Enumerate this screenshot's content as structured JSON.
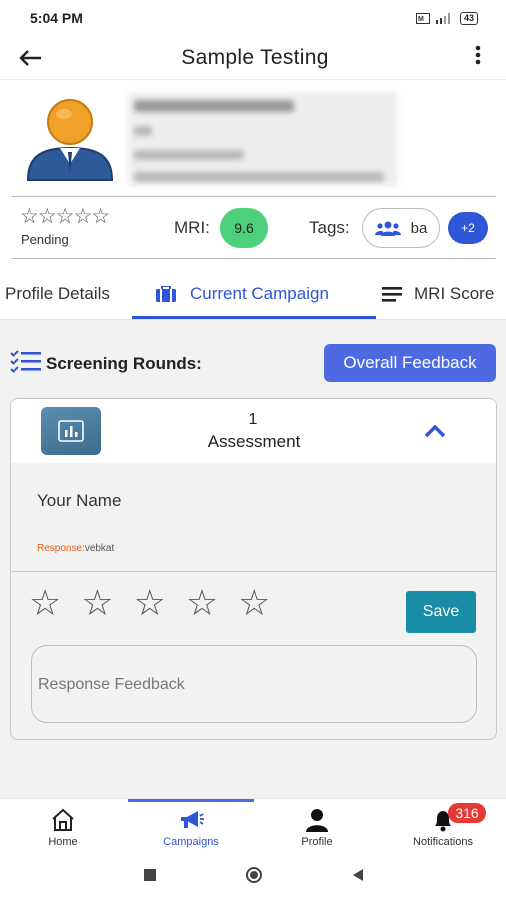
{
  "status_bar": {
    "time": "5:04 PM",
    "battery": "43"
  },
  "app_bar": {
    "back_icon": "arrow-left-icon",
    "title": "Sample Testing",
    "more_icon": "more-vertical-icon"
  },
  "profile": {
    "avatar_icon": "user-avatar-icon"
  },
  "meta": {
    "rating_stars": "☆☆☆☆☆",
    "status": "Pending",
    "mri_label": "MRI:",
    "mri_value": "9.6",
    "mri_color": "#4cd07a",
    "tags_label": "Tags:",
    "tag_icon": "group-icon",
    "tag_text": "ba",
    "tag_more": "+2"
  },
  "tabs": [
    {
      "label": "Profile Details"
    },
    {
      "label": "Current Campaign",
      "icon": "briefcase-icon",
      "active": true
    },
    {
      "label": "MRI Score",
      "icon": "menu-lines-icon"
    }
  ],
  "screening": {
    "icon": "checklist-icon",
    "label": "Screening Rounds:",
    "overall_feedback": "Overall Feedback"
  },
  "assessment": {
    "icon": "chart-icon",
    "number": "1",
    "title": "Assessment",
    "question": "Your Name",
    "response_key": "Response:",
    "response_value": "vebkat",
    "rating": "☆",
    "save_label": "Save",
    "feedback_placeholder": "Response Feedback"
  },
  "bottom_nav": [
    {
      "label": "Home",
      "icon": "home-icon"
    },
    {
      "label": "Campaigns",
      "icon": "megaphone-icon",
      "active": true
    },
    {
      "label": "Profile",
      "icon": "person-icon"
    },
    {
      "label": "Notifications",
      "icon": "bell-icon",
      "badge": "316"
    }
  ],
  "colors": {
    "accent": "#2e56d6",
    "button": "#4e6ae3",
    "save": "#1a8da6",
    "badge": "#e53935"
  }
}
